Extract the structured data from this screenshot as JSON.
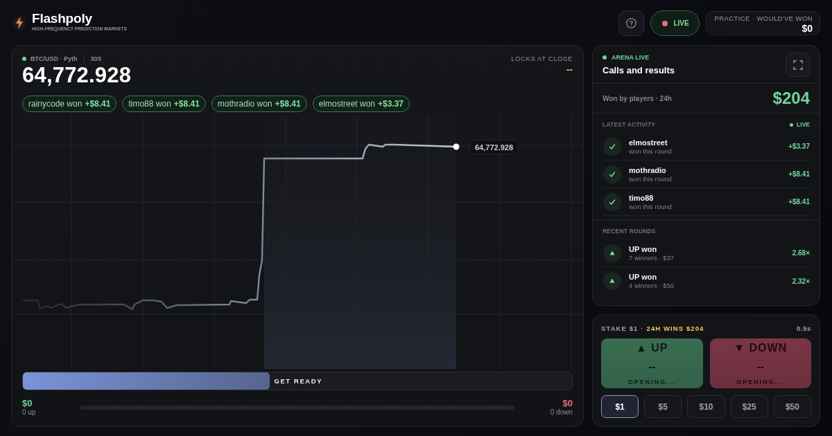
{
  "header": {
    "brand": "Flashpoly",
    "tagline": "HIGH-FREQUENCY PREDICTION MARKETS",
    "live_button": "LIVE",
    "practice": {
      "label": "PRACTICE · WOULD'VE WON",
      "value": "$0"
    }
  },
  "market": {
    "pair": "BTC/USD · Pyth",
    "interval": "30S",
    "price": "64,772.928",
    "lock_label": "LOCKS AT CLOSE",
    "lock_value": "--",
    "wins": [
      {
        "text": "rainycode won **+$8.41**"
      },
      {
        "text": "timo88 won **+$8.41**"
      },
      {
        "text": "mothradio won **+$8.41**"
      },
      {
        "text": "elmostreet won **+$3.37**"
      }
    ],
    "chart": {
      "price_tag": "64,772.928"
    },
    "progress": {
      "label": "GET READY",
      "level": 0.45
    },
    "pool": {
      "up_amount": "$0",
      "up_count": "0 up",
      "down_amount": "$0",
      "down_count": "0 down"
    }
  },
  "arena": {
    "status": "ARENA LIVE",
    "title": "Calls and results",
    "won_label": "Won by players · 24h",
    "won_value": "$204",
    "activity_label": "LATEST ACTIVITY",
    "activity_status": "LIVE",
    "activity": [
      {
        "name": "elmostreet",
        "detail": "won this round",
        "amount": "+$3.37"
      },
      {
        "name": "mothradio",
        "detail": "won this round",
        "amount": "+$8.41"
      },
      {
        "name": "timo88",
        "detail": "won this round",
        "amount": "+$8.41"
      }
    ],
    "rounds_label": "RECENT ROUNDS",
    "rounds": [
      {
        "kind": "up",
        "title": "UP won",
        "detail": "7 winners · $37",
        "multiplier": "2.68×"
      },
      {
        "kind": "up",
        "title": "UP won",
        "detail": "4 winners · $50",
        "multiplier": "2.32×"
      }
    ]
  },
  "trade": {
    "stake_label": "STAKE $1 ·",
    "wins_label": "24H WINS $204",
    "timer": "0.5s",
    "sides": [
      {
        "kind": "up",
        "label": "▲ UP",
        "price": "--",
        "status": "OPENING..."
      },
      {
        "kind": "down",
        "label": "▼ DOWN",
        "price": "--",
        "status": "OPENING..."
      }
    ],
    "stakes": [
      {
        "label": "$1",
        "selected": true
      },
      {
        "label": "$5",
        "selected": false
      },
      {
        "label": "$10",
        "selected": false
      },
      {
        "label": "$25",
        "selected": false
      },
      {
        "label": "$50",
        "selected": false
      }
    ]
  }
}
